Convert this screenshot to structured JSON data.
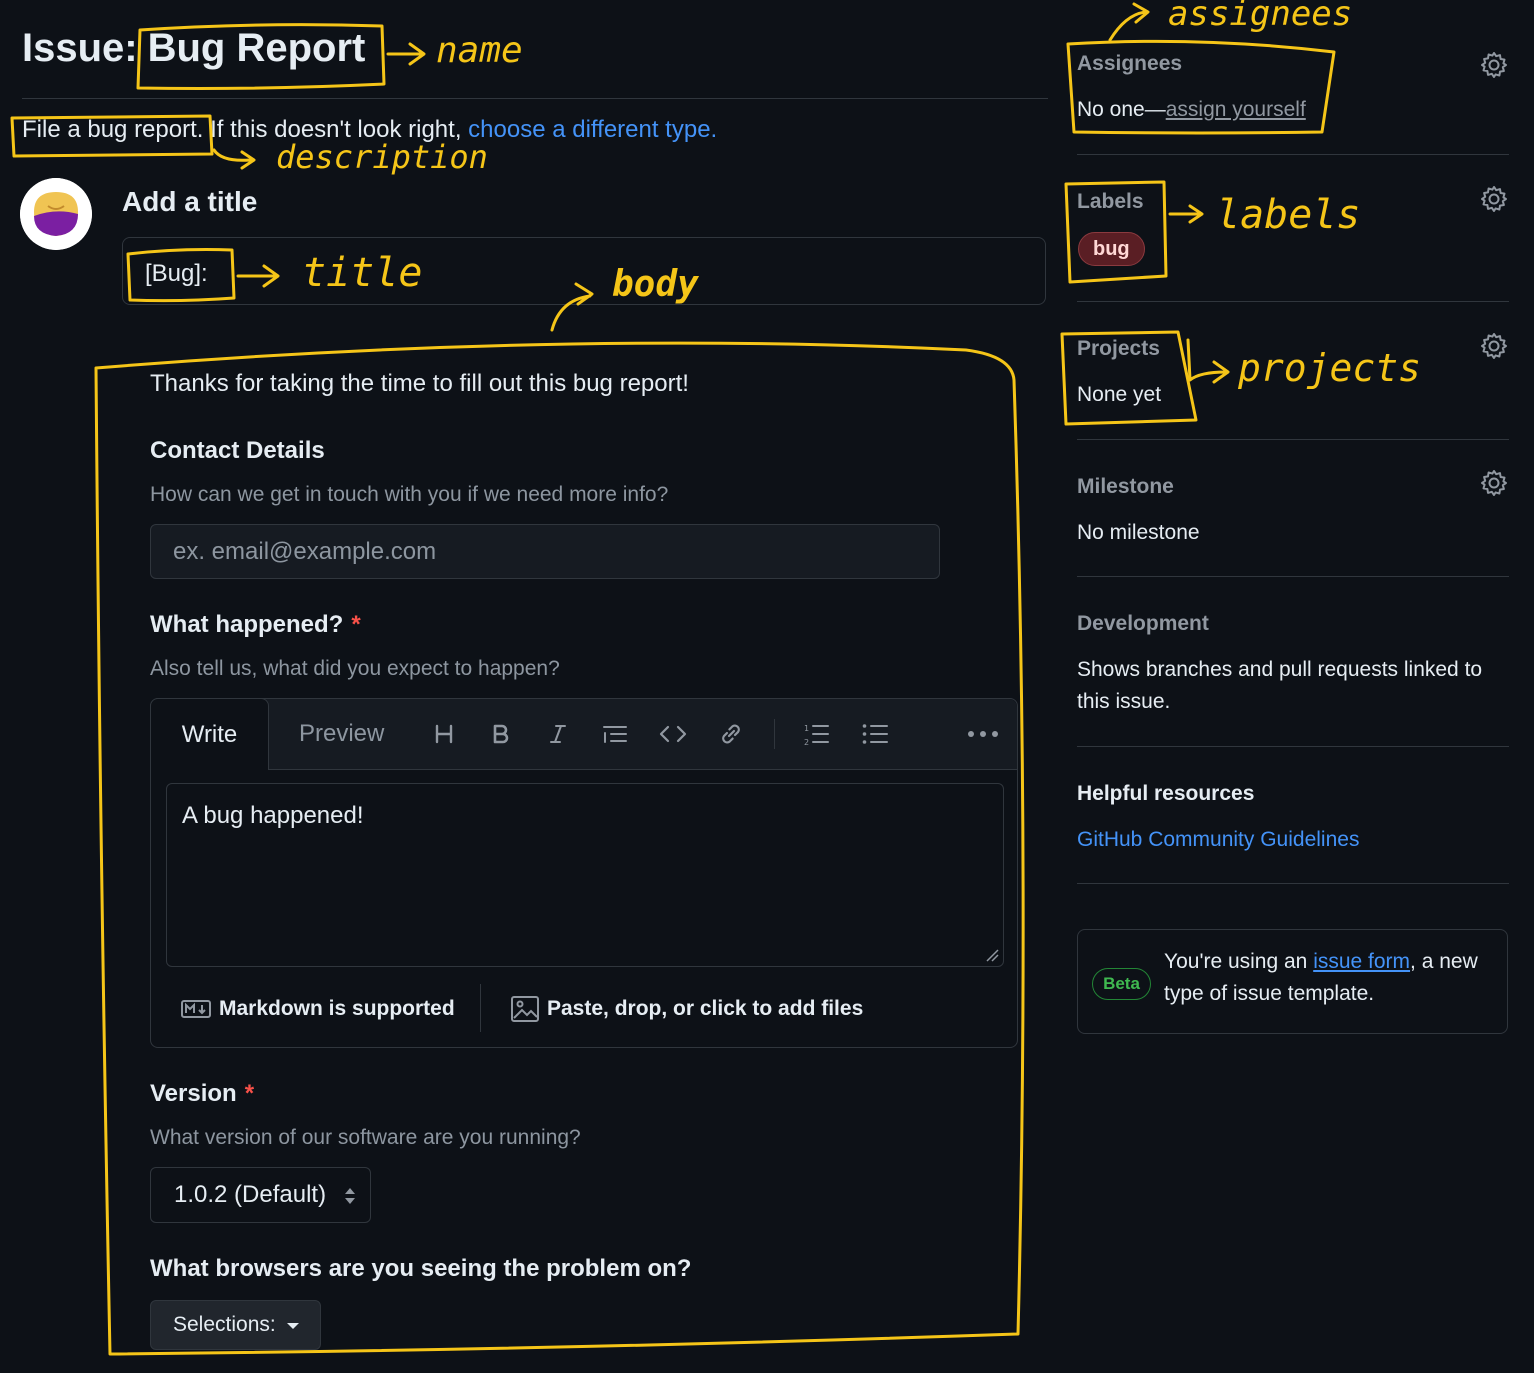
{
  "header": {
    "prefix": "Issue:",
    "name": "Bug Report"
  },
  "description": {
    "text": "File a bug report.",
    "middle": " If this doesn't look right, ",
    "link": "choose a different type."
  },
  "title_field": {
    "label": "Add a title",
    "value": "[Bug]: "
  },
  "form": {
    "intro": "Thanks for taking the time to fill out this bug report!",
    "contact": {
      "label": "Contact Details",
      "help": "How can we get in touch with you if we need more info?",
      "placeholder": "ex. email@example.com"
    },
    "what_happened": {
      "label": "What happened?",
      "required_mark": "*",
      "help": "Also tell us, what did you expect to happen?",
      "tabs": [
        "Write",
        "Preview"
      ],
      "value": "A bug happened!",
      "markdown_note": "Markdown is supported",
      "attach_note": "Paste, drop, or click to add files",
      "toolbar_icons": [
        "heading-icon",
        "bold-icon",
        "italic-icon",
        "quote-icon",
        "code-icon",
        "link-icon",
        "ordered-list-icon",
        "unordered-list-icon",
        "more-icon"
      ]
    },
    "version": {
      "label": "Version",
      "required_mark": "*",
      "help": "What version of our software are you running?",
      "selected": "1.0.2 (Default)"
    },
    "browsers": {
      "label": "What browsers are you seeing the problem on?",
      "selected": "Selections:"
    }
  },
  "sidebar": {
    "assignees": {
      "title": "Assignees",
      "value": "No one—",
      "link": "assign yourself"
    },
    "labels": {
      "title": "Labels",
      "items": [
        "bug"
      ]
    },
    "projects": {
      "title": "Projects",
      "value": "None yet"
    },
    "milestone": {
      "title": "Milestone",
      "value": "No milestone"
    },
    "development": {
      "title": "Development",
      "value_line1": "Shows branches and pull requests linked to",
      "value_line2": "this issue."
    },
    "resources": {
      "title": "Helpful resources",
      "link": "GitHub Community Guidelines"
    },
    "beta": {
      "badge": "Beta",
      "text_before": "You're using an ",
      "link": "issue form",
      "text_after": ", a new type of issue template."
    }
  },
  "annotations": {
    "name": "name",
    "description": "description",
    "title": "title",
    "body": "body",
    "assignees": "assignees",
    "labels": "labels",
    "projects": "projects"
  },
  "colors": {
    "background": "#0d1117",
    "link": "#4493f8",
    "annotation": "#f5c518",
    "required": "#f85149",
    "label_bug_bg": "#5a1e24"
  }
}
